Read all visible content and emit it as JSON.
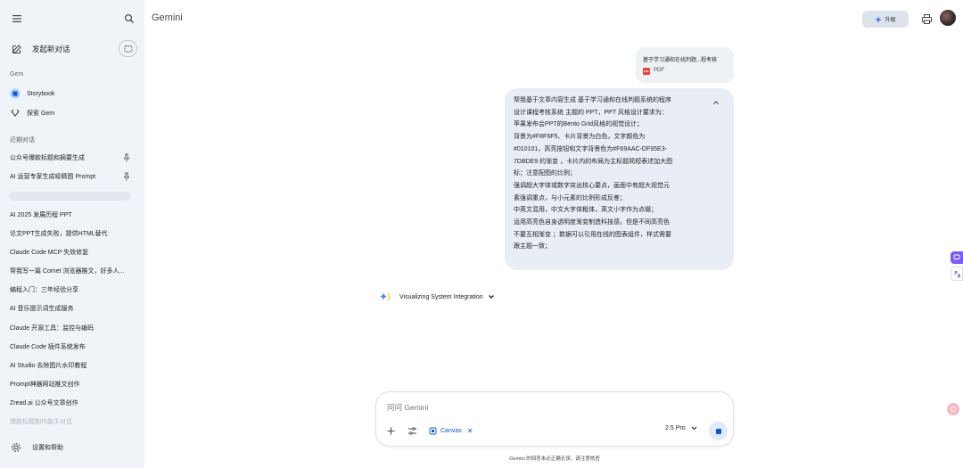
{
  "app": {
    "title": "Gemini"
  },
  "header": {
    "upgrade_label": "升级"
  },
  "sidebar": {
    "new_chat": "发起新对话",
    "gem_section": "Gem",
    "gems": [
      {
        "label": "Storybook",
        "icon": "storybook-icon"
      },
      {
        "label": "探索 Gem",
        "icon": "explore-gem-icon"
      }
    ],
    "recent_section": "近期对话",
    "pinned": [
      "公众号爆款标题和摘要生成",
      "AI 运营专家生成吸睛图 Prompt"
    ],
    "recent": [
      "AI 2025 发展历程 PPT",
      "论文PPT生成失败，提供HTML替代",
      "Claude Code MCP 失效修复",
      "帮我写一篇 Comet 浏览器推文，好多人...",
      "编程入门：三年经验分享",
      "AI 音乐提示词生成服务",
      "Claude 开源工具：监控与编码",
      "Claude Code 插件系统发布",
      "AI Studio 去除图片水印教程",
      "Prompt神器网站推文创作",
      "Zread.ai 公众号文章创作"
    ],
    "faded_item": "爆款标题制作能手对话",
    "settings": "设置和帮助"
  },
  "chat": {
    "file": {
      "name": "基于学习通和在线判题...程考核",
      "type": "PDF",
      "badge": "PDF"
    },
    "prompt_lines": [
      "帮我基于文章内容生成 基于学习通和在线判题系统的程序",
      "设计课程考核系统 主题的 PPT，PPT 风格设计要求为：",
      "苹果发布会PPT的Bento Grid风格的视觉设计；",
      "背景为#F8F6F5、卡片背景为白色，文字颜色为",
      "#010101，高亮按钮和文字背景色为#F69AAC-DF95E3-",
      "7DBDE9 的渐变 ，卡片内的布局为主标题简短表述加大图",
      "标；注意配图的比例；",
      "强调超大字体或数字突出核心要点，画面中有超大视觉元",
      "素强调重点，与小元素的比例形成反差；",
      "中英文混用，中文大字体粗体，英文小字作为点缀；",
      "运用高亮色自身透明度渐变制造科技感，但是不同高亮色",
      "不要互相渐变 ；数据可以引用在线的图表组件，样式需要",
      "跟主题一致；"
    ],
    "status": "Visualizing System Integration"
  },
  "composer": {
    "placeholder": "问问 Gemini",
    "canvas_label": "Canvas",
    "model_label": "2.5 Pro",
    "disclaimer": "Gemini 的回答未必正确无误，请注意核查"
  },
  "colors": {
    "sidebar_bg": "#f0f4f9",
    "bubble_bg": "#e9eef6",
    "accent": "#0b57d0",
    "pdf_red": "#ea4335"
  }
}
